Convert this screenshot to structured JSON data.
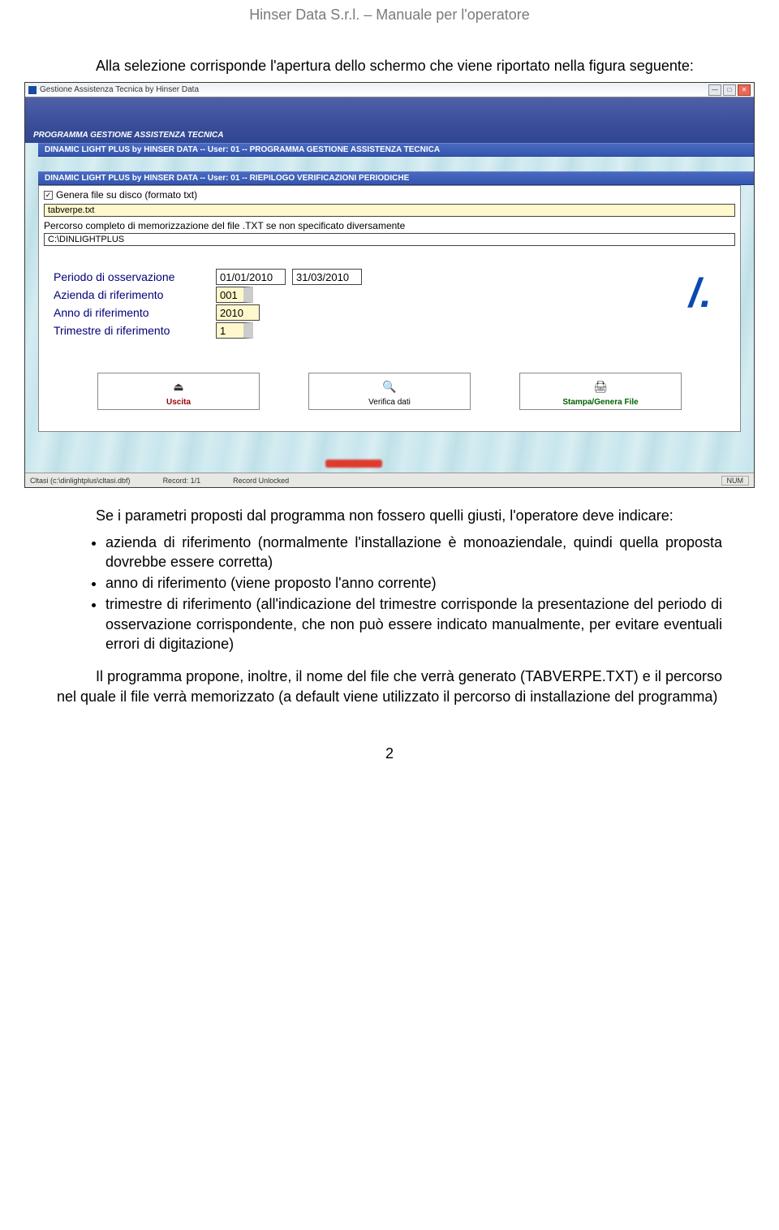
{
  "header": {
    "text": "Hinser Data S.r.l. – Manuale per l'operatore"
  },
  "intro_para": "Alla selezione corrisponde l'apertura dello schermo che viene riportato nella figura seguente:",
  "screenshot": {
    "appTitle": "Gestione Assistenza Tecnica by Hinser Data",
    "menu1": "PROGRAMMA GESTIONE ASSISTENZA TECNICA",
    "sub1": "DINAMIC LIGHT PLUS by HINSER DATA -- User: 01 -- PROGRAMMA GESTIONE ASSISTENZA TECNICA",
    "sub2": "DINAMIC LIGHT PLUS by HINSER DATA -- User: 01 -- RIEPILOGO VERIFICAZIONI PERIODICHE",
    "checkLabel": "Genera file su disco (formato txt)",
    "fileName": "tabverpe.txt",
    "pathLabel": "Percorso completo di memorizzazione del file .TXT se non specificato diversamente",
    "pathValue": "C:\\DINLIGHTPLUS",
    "fields": {
      "periodoLabel": "Periodo di osservazione",
      "periodoFrom": "01/01/2010",
      "periodoTo": "31/03/2010",
      "aziendaLabel": "Azienda di riferimento",
      "aziendaValue": "001",
      "annoLabel": "Anno di riferimento",
      "annoValue": "2010",
      "trimestreLabel": "Trimestre di riferimento",
      "trimestreValue": "1"
    },
    "buttons": {
      "uscita": "Uscita",
      "verifica": "Verifica dati",
      "stampa": "Stampa/Genera File"
    },
    "statusbar": {
      "left": "Cltasi (c:\\dinlightplus\\cltasi.dbf)",
      "rec": "Record: 1/1",
      "lock": "Record Unlocked",
      "num": "NUM"
    }
  },
  "para2": "Se i parametri proposti dal programma non fossero quelli giusti, l'operatore deve indicare:",
  "bullets": {
    "b1": "azienda di riferimento (normalmente l'installazione è monoaziendale, quindi quella proposta dovrebbe essere corretta)",
    "b2": "anno di riferimento (viene proposto l'anno corrente)",
    "b3": "trimestre di riferimento (all'indicazione del trimestre corrisponde la presentazione del periodo di osservazione corrispondente, che non può essere indicato manualmente, per evitare eventuali errori di digitazione)"
  },
  "para3": "Il programma propone, inoltre, il nome del file che verrà generato (TABVERPE.TXT) e il percorso nel quale il file verrà memorizzato (a default viene utilizzato il percorso di installazione del programma)",
  "pageNumber": "2"
}
